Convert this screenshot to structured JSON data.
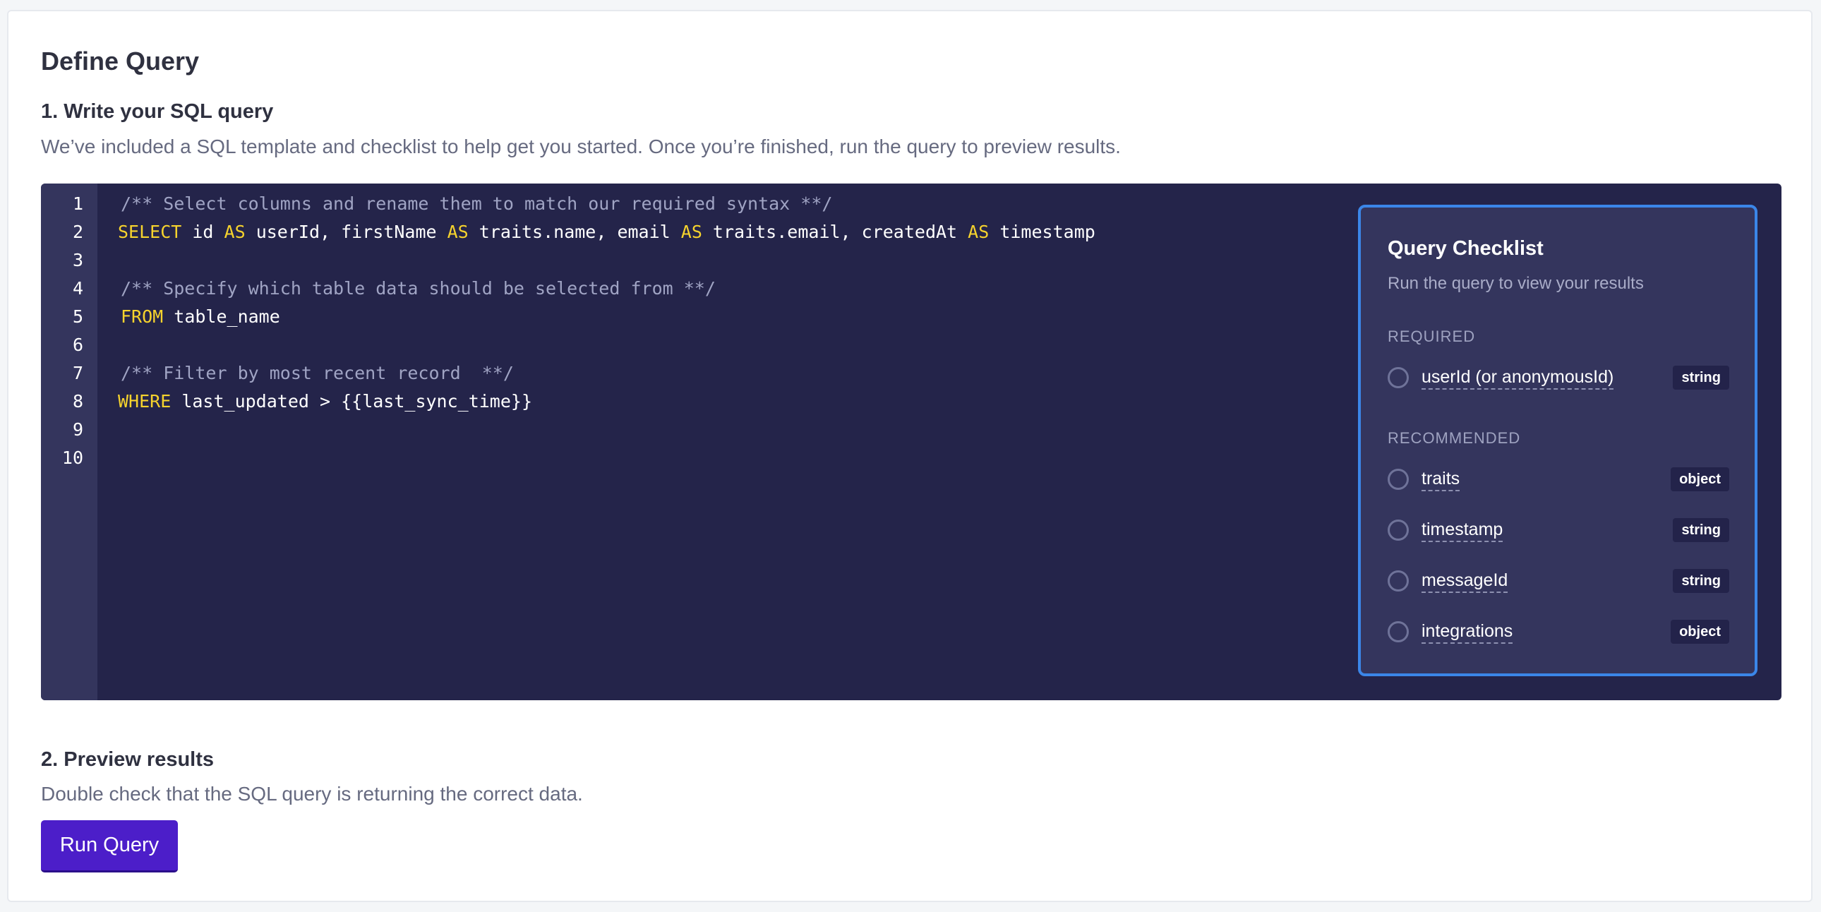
{
  "page": {
    "title": "Define Query"
  },
  "step1": {
    "title": "1. Write your SQL query",
    "description": "We’ve included a SQL template and checklist to help get you started. Once you’re finished, run the query to preview results."
  },
  "editor": {
    "line_numbers": [
      "1",
      "2",
      "3",
      "4",
      "5",
      "6",
      "7",
      "8",
      "9",
      "10"
    ],
    "code": {
      "l1_comment": "/** Select columns and rename them to match our required syntax **/",
      "l2_select": "SELECT",
      "l2_a": " id ",
      "l2_as1": "AS",
      "l2_b": " userId, firstName ",
      "l2_as2": "AS",
      "l2_c": " traits.name, email ",
      "l2_as3": "AS",
      "l2_d": " traits.email, createdAt ",
      "l2_as4": "AS",
      "l2_e": " timestamp",
      "l4_comment": "/** Specify which table data should be selected from **/",
      "l5_from": "FROM",
      "l5_rest": " table_name",
      "l7_comment": "/** Filter by most recent record  **/",
      "l8_where": "WHERE",
      "l8_rest": " last_updated > {{last_sync_time}}"
    },
    "keyword_color": "#f6d32d"
  },
  "checklist": {
    "title": "Query Checklist",
    "subtitle": "Run the query to view your results",
    "required_heading": "REQUIRED",
    "recommended_heading": "RECOMMENDED",
    "required": [
      {
        "label": "userId (or anonymousId)",
        "type": "string"
      }
    ],
    "recommended": [
      {
        "label": "traits",
        "type": "object"
      },
      {
        "label": "timestamp",
        "type": "string"
      },
      {
        "label": "messageId",
        "type": "string"
      },
      {
        "label": "integrations",
        "type": "object"
      }
    ],
    "border_color": "#3b86e8"
  },
  "step2": {
    "title": "2. Preview results",
    "description": "Double check that the SQL query is returning the correct data.",
    "run_button": "Run Query"
  },
  "colors": {
    "editor_bg": "#24244a",
    "primary_button": "#4c1ec9"
  }
}
